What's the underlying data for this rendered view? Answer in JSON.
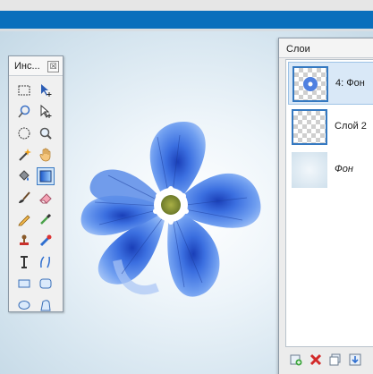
{
  "window": {
    "accent_color": "#0a6fbc"
  },
  "tools_panel": {
    "title": "Инс...",
    "close_glyph": "☒",
    "tools": [
      {
        "name": "rect-select-tool",
        "icon": "dotted-rect-icon"
      },
      {
        "name": "move-selection-tool",
        "icon": "arrow-move-icon"
      },
      {
        "name": "lasso-tool",
        "icon": "lasso-icon"
      },
      {
        "name": "move-pixels-tool",
        "icon": "arrow-outline-icon"
      },
      {
        "name": "ellipse-select-tool",
        "icon": "dotted-ellipse-icon"
      },
      {
        "name": "zoom-tool",
        "icon": "magnifier-icon"
      },
      {
        "name": "magic-wand-tool",
        "icon": "magic-wand-icon"
      },
      {
        "name": "pan-tool",
        "icon": "hand-icon"
      },
      {
        "name": "paint-bucket-tool",
        "icon": "bucket-icon"
      },
      {
        "name": "gradient-tool",
        "icon": "gradient-icon",
        "active": true
      },
      {
        "name": "paintbrush-tool",
        "icon": "brush-icon"
      },
      {
        "name": "eraser-tool",
        "icon": "eraser-icon"
      },
      {
        "name": "pencil-tool",
        "icon": "pencil-icon"
      },
      {
        "name": "color-picker-tool",
        "icon": "eyedropper-icon"
      },
      {
        "name": "clone-stamp-tool",
        "icon": "stamp-icon"
      },
      {
        "name": "recolor-tool",
        "icon": "recolor-icon"
      },
      {
        "name": "text-tool",
        "icon": "text-icon"
      },
      {
        "name": "line-tool",
        "icon": "line-curve-icon"
      },
      {
        "name": "rectangle-tool",
        "icon": "rectangle-icon"
      },
      {
        "name": "rounded-rectangle-tool",
        "icon": "rounded-rect-icon"
      },
      {
        "name": "ellipse-tool",
        "icon": "ellipse-icon"
      },
      {
        "name": "freeform-shape-tool",
        "icon": "freeform-icon"
      }
    ]
  },
  "layers_panel": {
    "title": "Слои",
    "layers": [
      {
        "name": "4: Фон",
        "selected": true,
        "thumb": "flower"
      },
      {
        "name": "Слой 2",
        "selected": false,
        "thumb": "transparent"
      },
      {
        "name": "Фон",
        "selected": false,
        "thumb": "background",
        "italic": true
      }
    ],
    "footer_buttons": [
      {
        "name": "add-layer-button",
        "icon": "add-layer-icon"
      },
      {
        "name": "delete-layer-button",
        "icon": "delete-x-icon"
      },
      {
        "name": "duplicate-layer-button",
        "icon": "duplicate-icon"
      },
      {
        "name": "merge-down-button",
        "icon": "merge-down-icon"
      }
    ]
  }
}
